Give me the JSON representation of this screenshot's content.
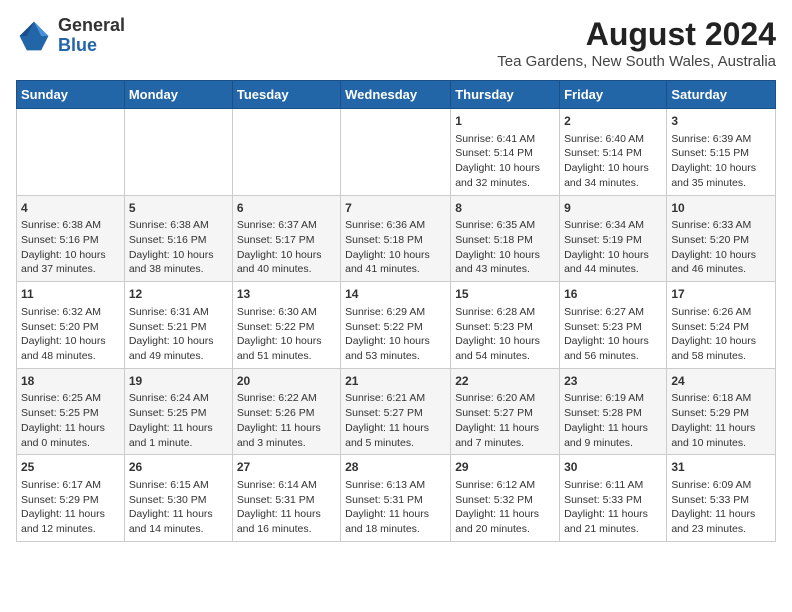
{
  "header": {
    "logo_line1": "General",
    "logo_line2": "Blue",
    "title": "August 2024",
    "subtitle": "Tea Gardens, New South Wales, Australia"
  },
  "days_of_week": [
    "Sunday",
    "Monday",
    "Tuesday",
    "Wednesday",
    "Thursday",
    "Friday",
    "Saturday"
  ],
  "weeks": [
    [
      {
        "day": "",
        "content": ""
      },
      {
        "day": "",
        "content": ""
      },
      {
        "day": "",
        "content": ""
      },
      {
        "day": "",
        "content": ""
      },
      {
        "day": "1",
        "content": "Sunrise: 6:41 AM\nSunset: 5:14 PM\nDaylight: 10 hours\nand 32 minutes."
      },
      {
        "day": "2",
        "content": "Sunrise: 6:40 AM\nSunset: 5:14 PM\nDaylight: 10 hours\nand 34 minutes."
      },
      {
        "day": "3",
        "content": "Sunrise: 6:39 AM\nSunset: 5:15 PM\nDaylight: 10 hours\nand 35 minutes."
      }
    ],
    [
      {
        "day": "4",
        "content": "Sunrise: 6:38 AM\nSunset: 5:16 PM\nDaylight: 10 hours\nand 37 minutes."
      },
      {
        "day": "5",
        "content": "Sunrise: 6:38 AM\nSunset: 5:16 PM\nDaylight: 10 hours\nand 38 minutes."
      },
      {
        "day": "6",
        "content": "Sunrise: 6:37 AM\nSunset: 5:17 PM\nDaylight: 10 hours\nand 40 minutes."
      },
      {
        "day": "7",
        "content": "Sunrise: 6:36 AM\nSunset: 5:18 PM\nDaylight: 10 hours\nand 41 minutes."
      },
      {
        "day": "8",
        "content": "Sunrise: 6:35 AM\nSunset: 5:18 PM\nDaylight: 10 hours\nand 43 minutes."
      },
      {
        "day": "9",
        "content": "Sunrise: 6:34 AM\nSunset: 5:19 PM\nDaylight: 10 hours\nand 44 minutes."
      },
      {
        "day": "10",
        "content": "Sunrise: 6:33 AM\nSunset: 5:20 PM\nDaylight: 10 hours\nand 46 minutes."
      }
    ],
    [
      {
        "day": "11",
        "content": "Sunrise: 6:32 AM\nSunset: 5:20 PM\nDaylight: 10 hours\nand 48 minutes."
      },
      {
        "day": "12",
        "content": "Sunrise: 6:31 AM\nSunset: 5:21 PM\nDaylight: 10 hours\nand 49 minutes."
      },
      {
        "day": "13",
        "content": "Sunrise: 6:30 AM\nSunset: 5:22 PM\nDaylight: 10 hours\nand 51 minutes."
      },
      {
        "day": "14",
        "content": "Sunrise: 6:29 AM\nSunset: 5:22 PM\nDaylight: 10 hours\nand 53 minutes."
      },
      {
        "day": "15",
        "content": "Sunrise: 6:28 AM\nSunset: 5:23 PM\nDaylight: 10 hours\nand 54 minutes."
      },
      {
        "day": "16",
        "content": "Sunrise: 6:27 AM\nSunset: 5:23 PM\nDaylight: 10 hours\nand 56 minutes."
      },
      {
        "day": "17",
        "content": "Sunrise: 6:26 AM\nSunset: 5:24 PM\nDaylight: 10 hours\nand 58 minutes."
      }
    ],
    [
      {
        "day": "18",
        "content": "Sunrise: 6:25 AM\nSunset: 5:25 PM\nDaylight: 11 hours\nand 0 minutes."
      },
      {
        "day": "19",
        "content": "Sunrise: 6:24 AM\nSunset: 5:25 PM\nDaylight: 11 hours\nand 1 minute."
      },
      {
        "day": "20",
        "content": "Sunrise: 6:22 AM\nSunset: 5:26 PM\nDaylight: 11 hours\nand 3 minutes."
      },
      {
        "day": "21",
        "content": "Sunrise: 6:21 AM\nSunset: 5:27 PM\nDaylight: 11 hours\nand 5 minutes."
      },
      {
        "day": "22",
        "content": "Sunrise: 6:20 AM\nSunset: 5:27 PM\nDaylight: 11 hours\nand 7 minutes."
      },
      {
        "day": "23",
        "content": "Sunrise: 6:19 AM\nSunset: 5:28 PM\nDaylight: 11 hours\nand 9 minutes."
      },
      {
        "day": "24",
        "content": "Sunrise: 6:18 AM\nSunset: 5:29 PM\nDaylight: 11 hours\nand 10 minutes."
      }
    ],
    [
      {
        "day": "25",
        "content": "Sunrise: 6:17 AM\nSunset: 5:29 PM\nDaylight: 11 hours\nand 12 minutes."
      },
      {
        "day": "26",
        "content": "Sunrise: 6:15 AM\nSunset: 5:30 PM\nDaylight: 11 hours\nand 14 minutes."
      },
      {
        "day": "27",
        "content": "Sunrise: 6:14 AM\nSunset: 5:31 PM\nDaylight: 11 hours\nand 16 minutes."
      },
      {
        "day": "28",
        "content": "Sunrise: 6:13 AM\nSunset: 5:31 PM\nDaylight: 11 hours\nand 18 minutes."
      },
      {
        "day": "29",
        "content": "Sunrise: 6:12 AM\nSunset: 5:32 PM\nDaylight: 11 hours\nand 20 minutes."
      },
      {
        "day": "30",
        "content": "Sunrise: 6:11 AM\nSunset: 5:33 PM\nDaylight: 11 hours\nand 21 minutes."
      },
      {
        "day": "31",
        "content": "Sunrise: 6:09 AM\nSunset: 5:33 PM\nDaylight: 11 hours\nand 23 minutes."
      }
    ]
  ]
}
